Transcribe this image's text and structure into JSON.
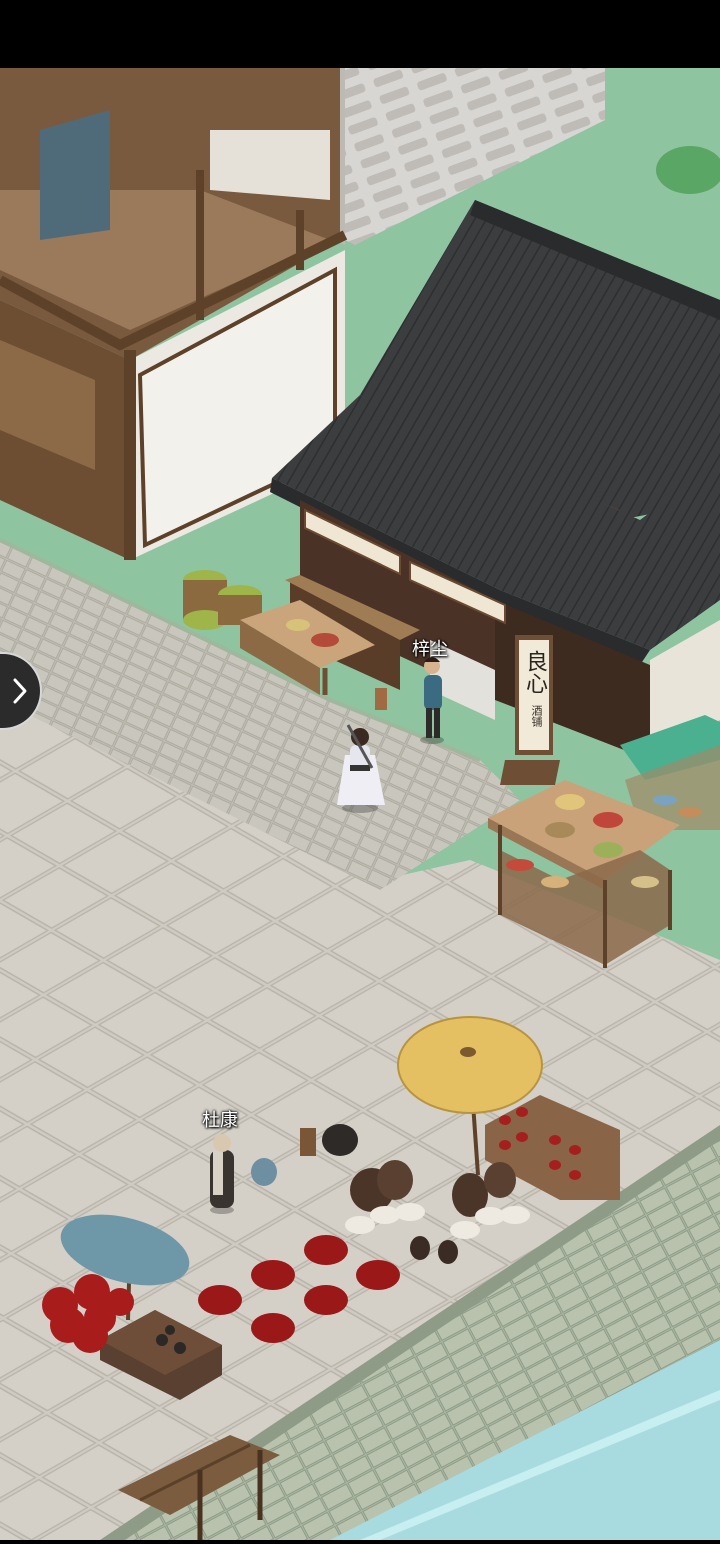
{
  "npcs": [
    {
      "name": "梓尘"
    },
    {
      "name": "杜康"
    }
  ],
  "shop_sign": {
    "main": "良心",
    "sub": "酒铺"
  },
  "controls": {
    "expand_icon": "chevron-right-icon"
  },
  "colors": {
    "top_bar": "#000000",
    "grass": "#8fc4a0",
    "plaza_tile": "#cfcbc3",
    "roof": "#3d3f40",
    "water": "#a8dbe0"
  }
}
